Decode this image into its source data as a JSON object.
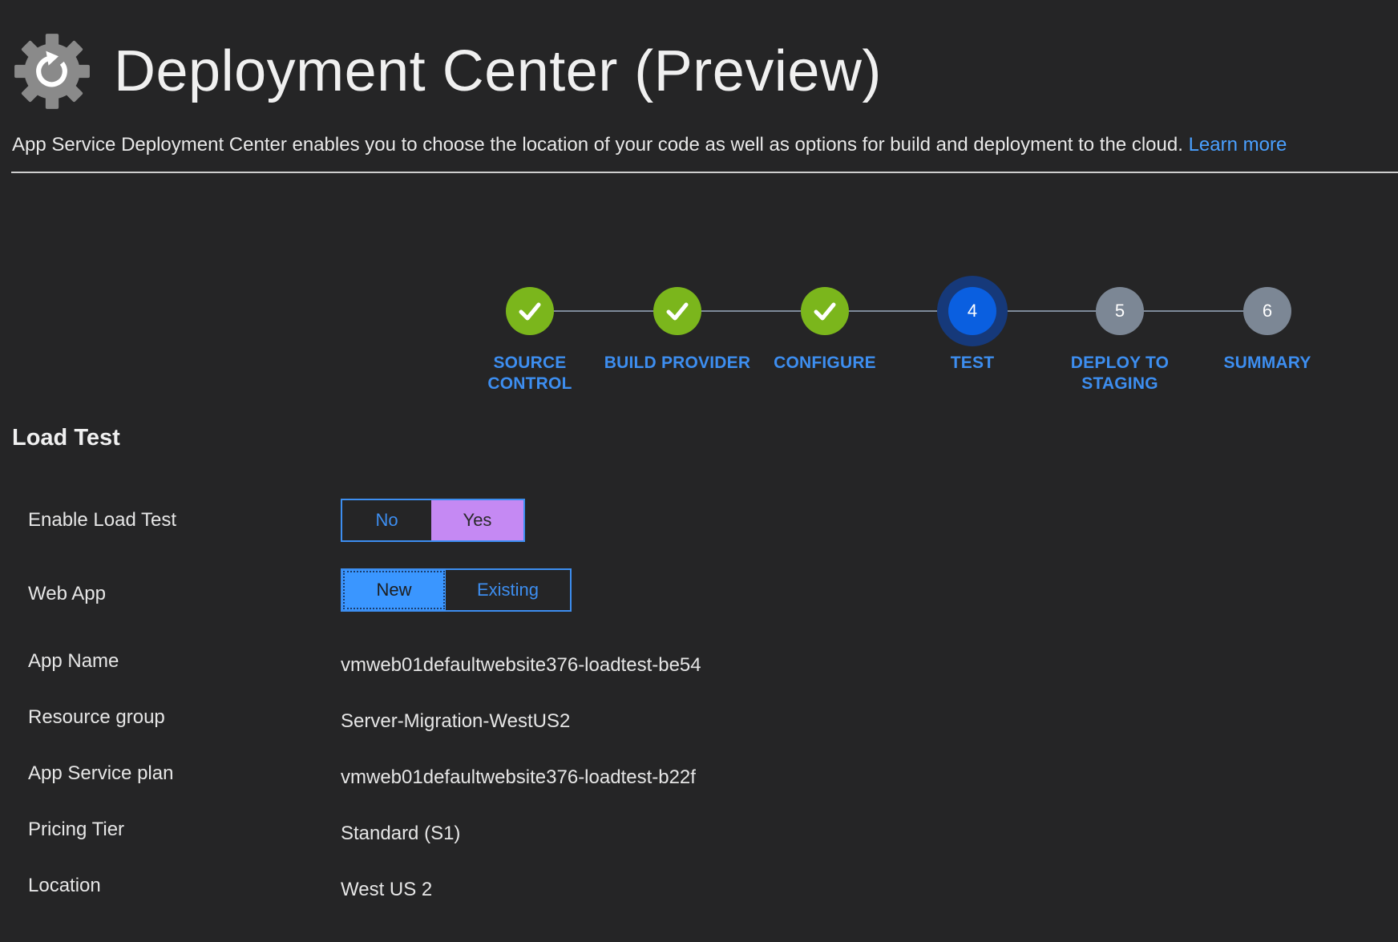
{
  "header": {
    "title": "Deployment Center (Preview)",
    "icon": "gear-refresh-icon",
    "description": "App Service Deployment Center enables you to choose the location of your code as well as options for build and deployment to the cloud.",
    "learn_more": "Learn more"
  },
  "stepper": {
    "steps": [
      {
        "label_line1": "SOURCE",
        "label_line2": "CONTROL",
        "state": "done",
        "number": "1"
      },
      {
        "label_line1": "BUILD PROVIDER",
        "label_line2": "",
        "state": "done",
        "number": "2"
      },
      {
        "label_line1": "CONFIGURE",
        "label_line2": "",
        "state": "done",
        "number": "3"
      },
      {
        "label_line1": "TEST",
        "label_line2": "",
        "state": "active",
        "number": "4"
      },
      {
        "label_line1": "DEPLOY TO",
        "label_line2": "STAGING",
        "state": "pending",
        "number": "5"
      },
      {
        "label_line1": "SUMMARY",
        "label_line2": "",
        "state": "pending",
        "number": "6"
      }
    ]
  },
  "section": {
    "title": "Load Test"
  },
  "form": {
    "enable_load_test": {
      "label": "Enable Load Test",
      "options": [
        "No",
        "Yes"
      ],
      "selected": "Yes"
    },
    "web_app": {
      "label": "Web App",
      "options": [
        "New",
        "Existing"
      ],
      "selected": "New"
    },
    "app_name": {
      "label": "App Name",
      "value": "vmweb01defaultwebsite376-loadtest-be54"
    },
    "resource_group": {
      "label": "Resource group",
      "value": "Server-Migration-WestUS2"
    },
    "app_service_plan": {
      "label": "App Service plan",
      "value": "vmweb01defaultwebsite376-loadtest-b22f"
    },
    "pricing_tier": {
      "label": "Pricing Tier",
      "value": "Standard (S1)"
    },
    "location": {
      "label": "Location",
      "value": "West US 2"
    }
  },
  "colors": {
    "background": "#252526",
    "accent": "#3d8ef0",
    "done": "#7bb61c",
    "active": "#0a5fe0",
    "pending": "#7c8795",
    "selected_purple": "#c589f3",
    "selected_blue": "#3a96ff"
  }
}
